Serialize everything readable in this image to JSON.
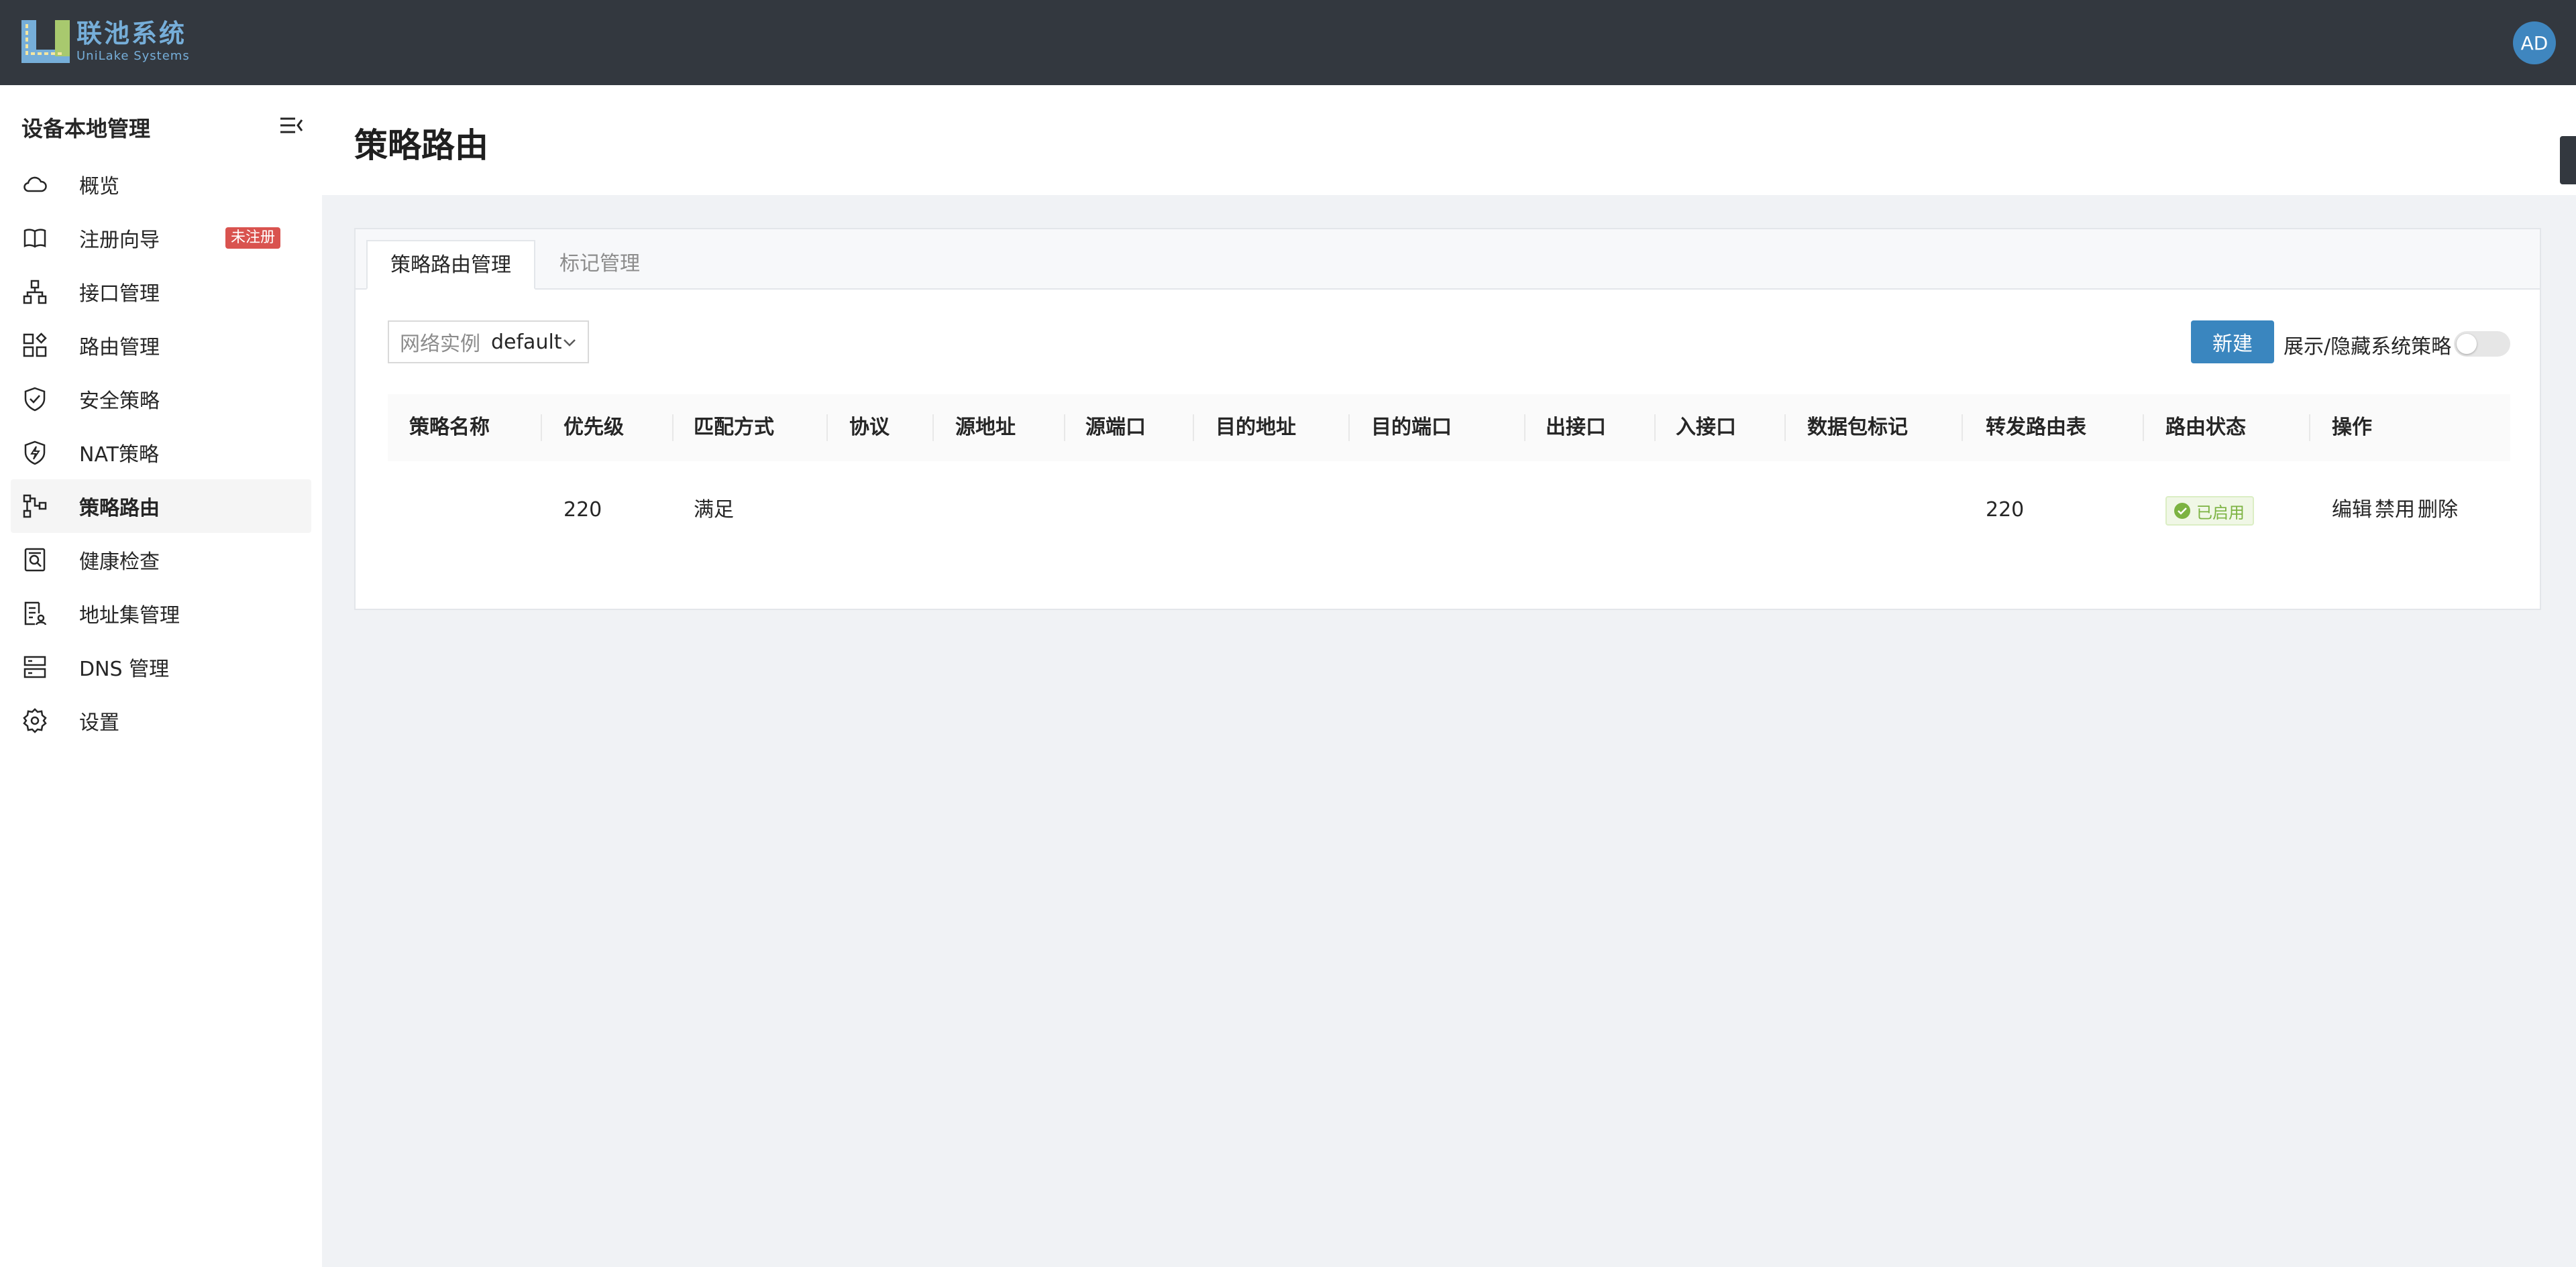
{
  "header": {
    "brand_cn": "联池系统",
    "brand_en": "UniLake Systems",
    "avatar_initials": "AD"
  },
  "sidebar": {
    "title": "设备本地管理",
    "items": [
      {
        "label": "概览",
        "icon": "cloud-icon"
      },
      {
        "label": "注册向导",
        "icon": "book-icon",
        "badge": "未注册"
      },
      {
        "label": "接口管理",
        "icon": "network-icon"
      },
      {
        "label": "路由管理",
        "icon": "apps-icon"
      },
      {
        "label": "安全策略",
        "icon": "shield-check-icon"
      },
      {
        "label": "NAT策略",
        "icon": "shield-flash-icon"
      },
      {
        "label": "策略路由",
        "icon": "flow-icon",
        "active": true
      },
      {
        "label": "健康检查",
        "icon": "monitor-search-icon"
      },
      {
        "label": "地址集管理",
        "icon": "list-user-icon"
      },
      {
        "label": "DNS 管理",
        "icon": "server-icon"
      },
      {
        "label": "设置",
        "icon": "gear-icon"
      }
    ]
  },
  "page": {
    "title": "策略路由"
  },
  "tabs": [
    {
      "label": "策略路由管理",
      "active": true
    },
    {
      "label": "标记管理",
      "active": false
    }
  ],
  "toolbar": {
    "instance_label": "网络实例",
    "instance_value": "default",
    "new_label": "新建",
    "toggle_label": "展示/隐藏系统策略",
    "toggle_on": false
  },
  "table": {
    "columns": [
      "策略名称",
      "优先级",
      "匹配方式",
      "协议",
      "源地址",
      "源端口",
      "目的地址",
      "目的端口",
      "出接口",
      "入接口",
      "数据包标记",
      "转发路由表",
      "路由状态",
      "操作"
    ],
    "rows": [
      {
        "name": "",
        "priority": "220",
        "match": "满足",
        "protocol": "",
        "src_addr": "",
        "src_port": "",
        "dst_addr": "",
        "dst_port": "",
        "out_if": "",
        "in_if": "",
        "mark": "",
        "table": "220",
        "status": "已启用",
        "actions": [
          "编辑",
          "禁用",
          "删除"
        ]
      }
    ]
  },
  "colors": {
    "topbar": "#33383f",
    "brand": "#76aed9",
    "primary": "#3a86bf",
    "badge": "#d9534f",
    "status_green": "#7cb342"
  }
}
